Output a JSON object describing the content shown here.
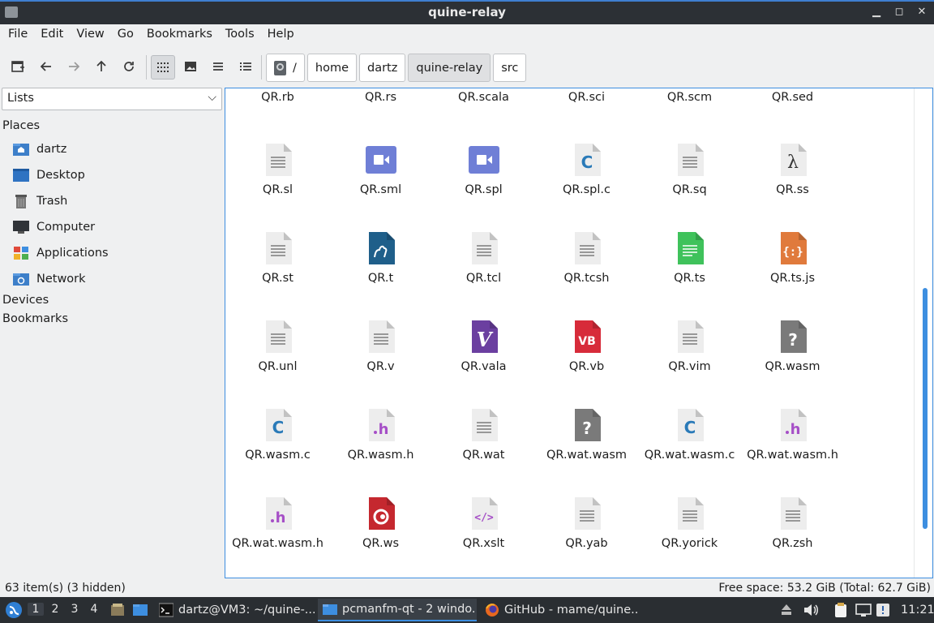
{
  "window": {
    "title": "quine-relay"
  },
  "menu": [
    "File",
    "Edit",
    "View",
    "Go",
    "Bookmarks",
    "Tools",
    "Help"
  ],
  "path": {
    "root": "/",
    "segments": [
      "home",
      "dartz",
      "quine-relay",
      "src"
    ],
    "current": "quine-relay"
  },
  "side": {
    "selector": "Lists",
    "places_header": "Places",
    "places": [
      {
        "label": "dartz",
        "icon": "home-folder-icon"
      },
      {
        "label": "Desktop",
        "icon": "desktop-icon"
      },
      {
        "label": "Trash",
        "icon": "trash-icon"
      },
      {
        "label": "Computer",
        "icon": "computer-icon"
      },
      {
        "label": "Applications",
        "icon": "applications-icon"
      },
      {
        "label": "Network",
        "icon": "network-icon"
      }
    ],
    "devices_header": "Devices",
    "bookmarks_header": "Bookmarks"
  },
  "files_partial": [
    "QR.rb",
    "QR.rs",
    "QR.scala",
    "QR.sci",
    "QR.scm",
    "QR.sed"
  ],
  "files": [
    {
      "name": "QR.sl",
      "icon": "text"
    },
    {
      "name": "QR.sml",
      "icon": "video"
    },
    {
      "name": "QR.spl",
      "icon": "video"
    },
    {
      "name": "QR.spl.c",
      "icon": "c"
    },
    {
      "name": "QR.sq",
      "icon": "text"
    },
    {
      "name": "QR.ss",
      "icon": "lambda"
    },
    {
      "name": "QR.st",
      "icon": "text"
    },
    {
      "name": "QR.t",
      "icon": "camel"
    },
    {
      "name": "QR.tcl",
      "icon": "text"
    },
    {
      "name": "QR.tcsh",
      "icon": "text"
    },
    {
      "name": "QR.ts",
      "icon": "spreadsheet"
    },
    {
      "name": "QR.ts.js",
      "icon": "js"
    },
    {
      "name": "QR.unl",
      "icon": "text"
    },
    {
      "name": "QR.v",
      "icon": "text"
    },
    {
      "name": "QR.vala",
      "icon": "vala"
    },
    {
      "name": "QR.vb",
      "icon": "vb"
    },
    {
      "name": "QR.vim",
      "icon": "text"
    },
    {
      "name": "QR.wasm",
      "icon": "unknown"
    },
    {
      "name": "QR.wasm.c",
      "icon": "c"
    },
    {
      "name": "QR.wasm.h",
      "icon": "h"
    },
    {
      "name": "QR.wat",
      "icon": "text"
    },
    {
      "name": "QR.wat.wasm",
      "icon": "unknown"
    },
    {
      "name": "QR.wat.wasm.c",
      "icon": "c"
    },
    {
      "name": "QR.wat.wasm.h",
      "icon": "h"
    },
    {
      "name": "QR.wat.wasm.h",
      "icon": "h"
    },
    {
      "name": "QR.ws",
      "icon": "ws"
    },
    {
      "name": "QR.xslt",
      "icon": "xml"
    },
    {
      "name": "QR.yab",
      "icon": "text"
    },
    {
      "name": "QR.yorick",
      "icon": "text"
    },
    {
      "name": "QR.zsh",
      "icon": "text"
    }
  ],
  "status": {
    "left": "63 item(s) (3 hidden)",
    "right": "Free space: 53.2 GiB (Total: 62.7 GiB)"
  },
  "taskbar": {
    "workspaces": [
      "1",
      "2",
      "3",
      "4"
    ],
    "active_workspace": "1",
    "tasks": [
      {
        "label": "dartz@VM3: ~/quine-...",
        "icon": "terminal-icon"
      },
      {
        "label": "pcmanfm-qt - 2 windo...",
        "icon": "folder-icon"
      },
      {
        "label": "GitHub - mame/quine...",
        "icon": "firefox-icon"
      }
    ],
    "clock": "11:21"
  },
  "colors": {
    "accent": "#3d8ee0",
    "video": "#6f7fd6",
    "c_blue": "#2a7ab8",
    "h_purple": "#a64fc7",
    "ts_green": "#3fc25b",
    "js_orange": "#e07a3c",
    "vala_purple": "#6b3fa0",
    "vb_red": "#d72b3a",
    "camel_blue": "#1f5f8a",
    "ws_red": "#c5282f",
    "unknown_gray": "#7a7a7a"
  }
}
